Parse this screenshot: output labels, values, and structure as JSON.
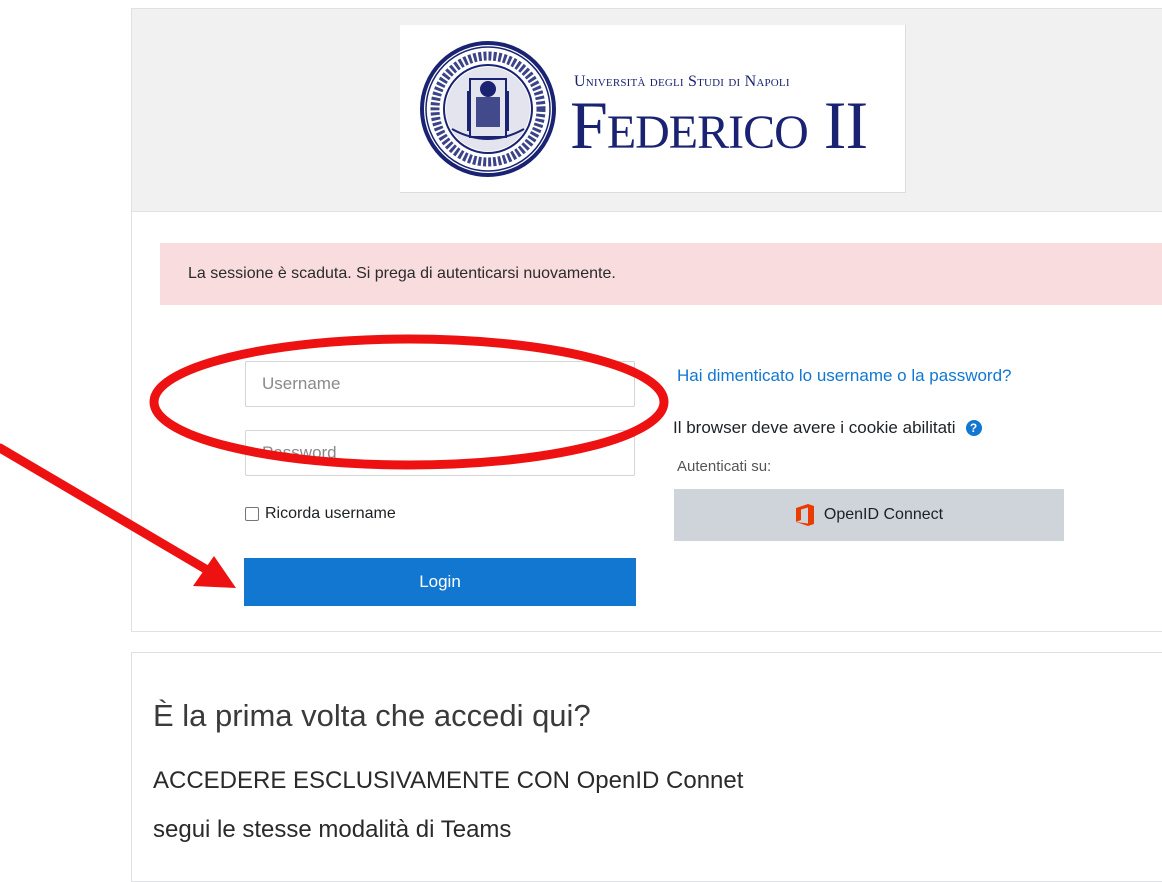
{
  "header": {
    "logo_top": "Università degli Studi di Napoli",
    "logo_main": "Federico II"
  },
  "alert": {
    "text": "La sessione è scaduta. Si prega di autenticarsi nuovamente."
  },
  "login_form": {
    "username_placeholder": "Username",
    "password_placeholder": "Password",
    "remember_label": "Ricorda username",
    "login_label": "Login"
  },
  "side": {
    "forgot_link": "Hai dimenticato lo username o la password?",
    "cookies_text": "Il browser deve avere i cookie abilitati",
    "auth_label": "Autenticati su:",
    "openid_label": "OpenID Connect"
  },
  "info": {
    "title": "È la prima volta che accedi qui?",
    "line1": "ACCEDERE ESCLUSIVAMENTE CON OpenID Connet",
    "line2": "segui le stesse modalità di Teams"
  },
  "icons": {
    "help": "question-circle-icon",
    "openid": "office-logo-icon"
  },
  "colors": {
    "brand": "#1a2372",
    "primary": "#1177d1",
    "alert_bg": "#f8dcde",
    "annotation": "#ee1111"
  }
}
